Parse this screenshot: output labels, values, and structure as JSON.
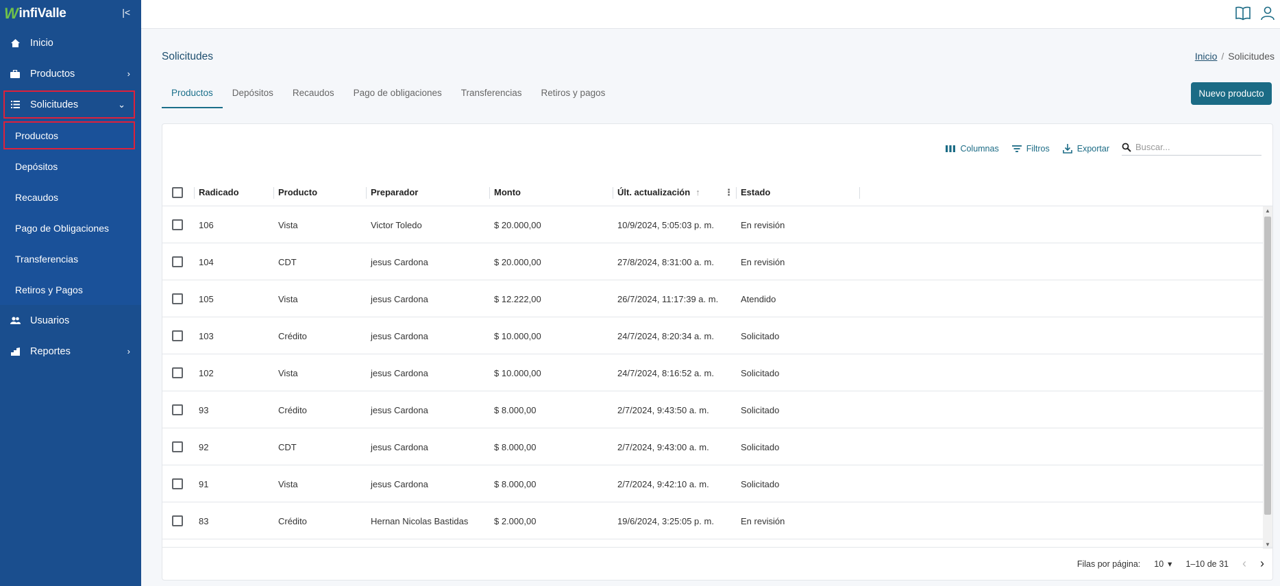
{
  "app": {
    "logo_mark": "W",
    "logo_text": "infiValle",
    "collapse_glyph": "|<"
  },
  "sidebar": {
    "items": [
      {
        "label": "Inicio",
        "icon": "home-icon"
      },
      {
        "label": "Productos",
        "icon": "briefcase-icon"
      },
      {
        "label": "Solicitudes",
        "icon": "list-icon"
      },
      {
        "label": "Usuarios",
        "icon": "users-icon"
      },
      {
        "label": "Reportes",
        "icon": "chart-icon"
      }
    ],
    "subitems": [
      "Productos",
      "Depósitos",
      "Recaudos",
      "Pago de Obligaciones",
      "Transferencias",
      "Retiros y Pagos"
    ]
  },
  "page": {
    "title": "Solicitudes",
    "breadcrumb_home": "Inicio",
    "breadcrumb_sep": "/",
    "breadcrumb_current": "Solicitudes"
  },
  "tabs": [
    "Productos",
    "Depósitos",
    "Recaudos",
    "Pago de obligaciones",
    "Transferencias",
    "Retiros y pagos"
  ],
  "new_button": "Nuevo producto",
  "toolbar": {
    "columns": "Columnas",
    "filters": "Filtros",
    "export": "Exportar",
    "search_placeholder": "Buscar..."
  },
  "table": {
    "headers": [
      "Radicado",
      "Producto",
      "Preparador",
      "Monto",
      "Últ. actualización",
      "Estado"
    ],
    "rows": [
      [
        "106",
        "Vista",
        "Victor Toledo",
        "$ 20.000,00",
        "10/9/2024, 5:05:03 p. m.",
        "En revisión"
      ],
      [
        "104",
        "CDT",
        "jesus Cardona",
        "$ 20.000,00",
        "27/8/2024, 8:31:00 a. m.",
        "En revisión"
      ],
      [
        "105",
        "Vista",
        "jesus Cardona",
        "$ 12.222,00",
        "26/7/2024, 11:17:39 a. m.",
        "Atendido"
      ],
      [
        "103",
        "Crédito",
        "jesus Cardona",
        "$ 10.000,00",
        "24/7/2024, 8:20:34 a. m.",
        "Solicitado"
      ],
      [
        "102",
        "Vista",
        "jesus Cardona",
        "$ 10.000,00",
        "24/7/2024, 8:16:52 a. m.",
        "Solicitado"
      ],
      [
        "93",
        "Crédito",
        "jesus Cardona",
        "$ 8.000,00",
        "2/7/2024, 9:43:50 a. m.",
        "Solicitado"
      ],
      [
        "92",
        "CDT",
        "jesus Cardona",
        "$ 8.000,00",
        "2/7/2024, 9:43:00 a. m.",
        "Solicitado"
      ],
      [
        "91",
        "Vista",
        "jesus Cardona",
        "$ 8.000,00",
        "2/7/2024, 9:42:10 a. m.",
        "Solicitado"
      ],
      [
        "83",
        "Crédito",
        "Hernan Nicolas Bastidas",
        "$ 2.000,00",
        "19/6/2024, 3:25:05 p. m.",
        "En revisión"
      ]
    ]
  },
  "pagination": {
    "rows_per_page_label": "Filas por página:",
    "rows_per_page": "10",
    "range": "1–10 de 31"
  },
  "colors": {
    "sidebar": "#1a4e8e",
    "accent": "#1b6b85",
    "highlight_box": "#e0203a"
  }
}
